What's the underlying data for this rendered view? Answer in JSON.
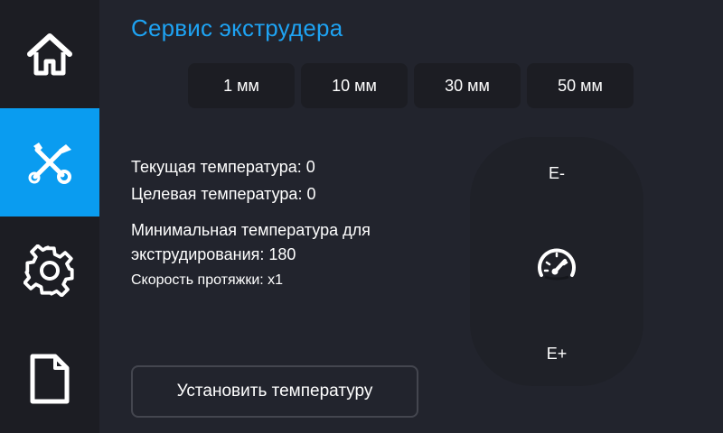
{
  "title": "Сервис экструдера",
  "sidebar": {
    "items": [
      {
        "icon": "home-icon",
        "active": false
      },
      {
        "icon": "tools-icon",
        "active": true
      },
      {
        "icon": "gear-icon",
        "active": false
      },
      {
        "icon": "file-icon",
        "active": false
      }
    ]
  },
  "steps": [
    {
      "label": "1 мм",
      "selected": true
    },
    {
      "label": "10 мм",
      "selected": false
    },
    {
      "label": "30 мм",
      "selected": false
    },
    {
      "label": "50 мм",
      "selected": false
    }
  ],
  "info": {
    "current_temp": "Текущая температура: 0",
    "target_temp": "Целевая температура: 0",
    "min_temp_line1": "Минимальная температура для",
    "min_temp_line2": "экструдирования: 180",
    "speed": "Скорость протяжки: x1"
  },
  "pad": {
    "retract_label": "E-",
    "extrude_label": "E+",
    "speed_icon": "speedometer-icon"
  },
  "set_temp_button": "Установить температуру",
  "colors": {
    "accent": "#0a9cf0",
    "title": "#1ea3f3",
    "background": "#22242d",
    "sidebar": "#1c1d23"
  }
}
